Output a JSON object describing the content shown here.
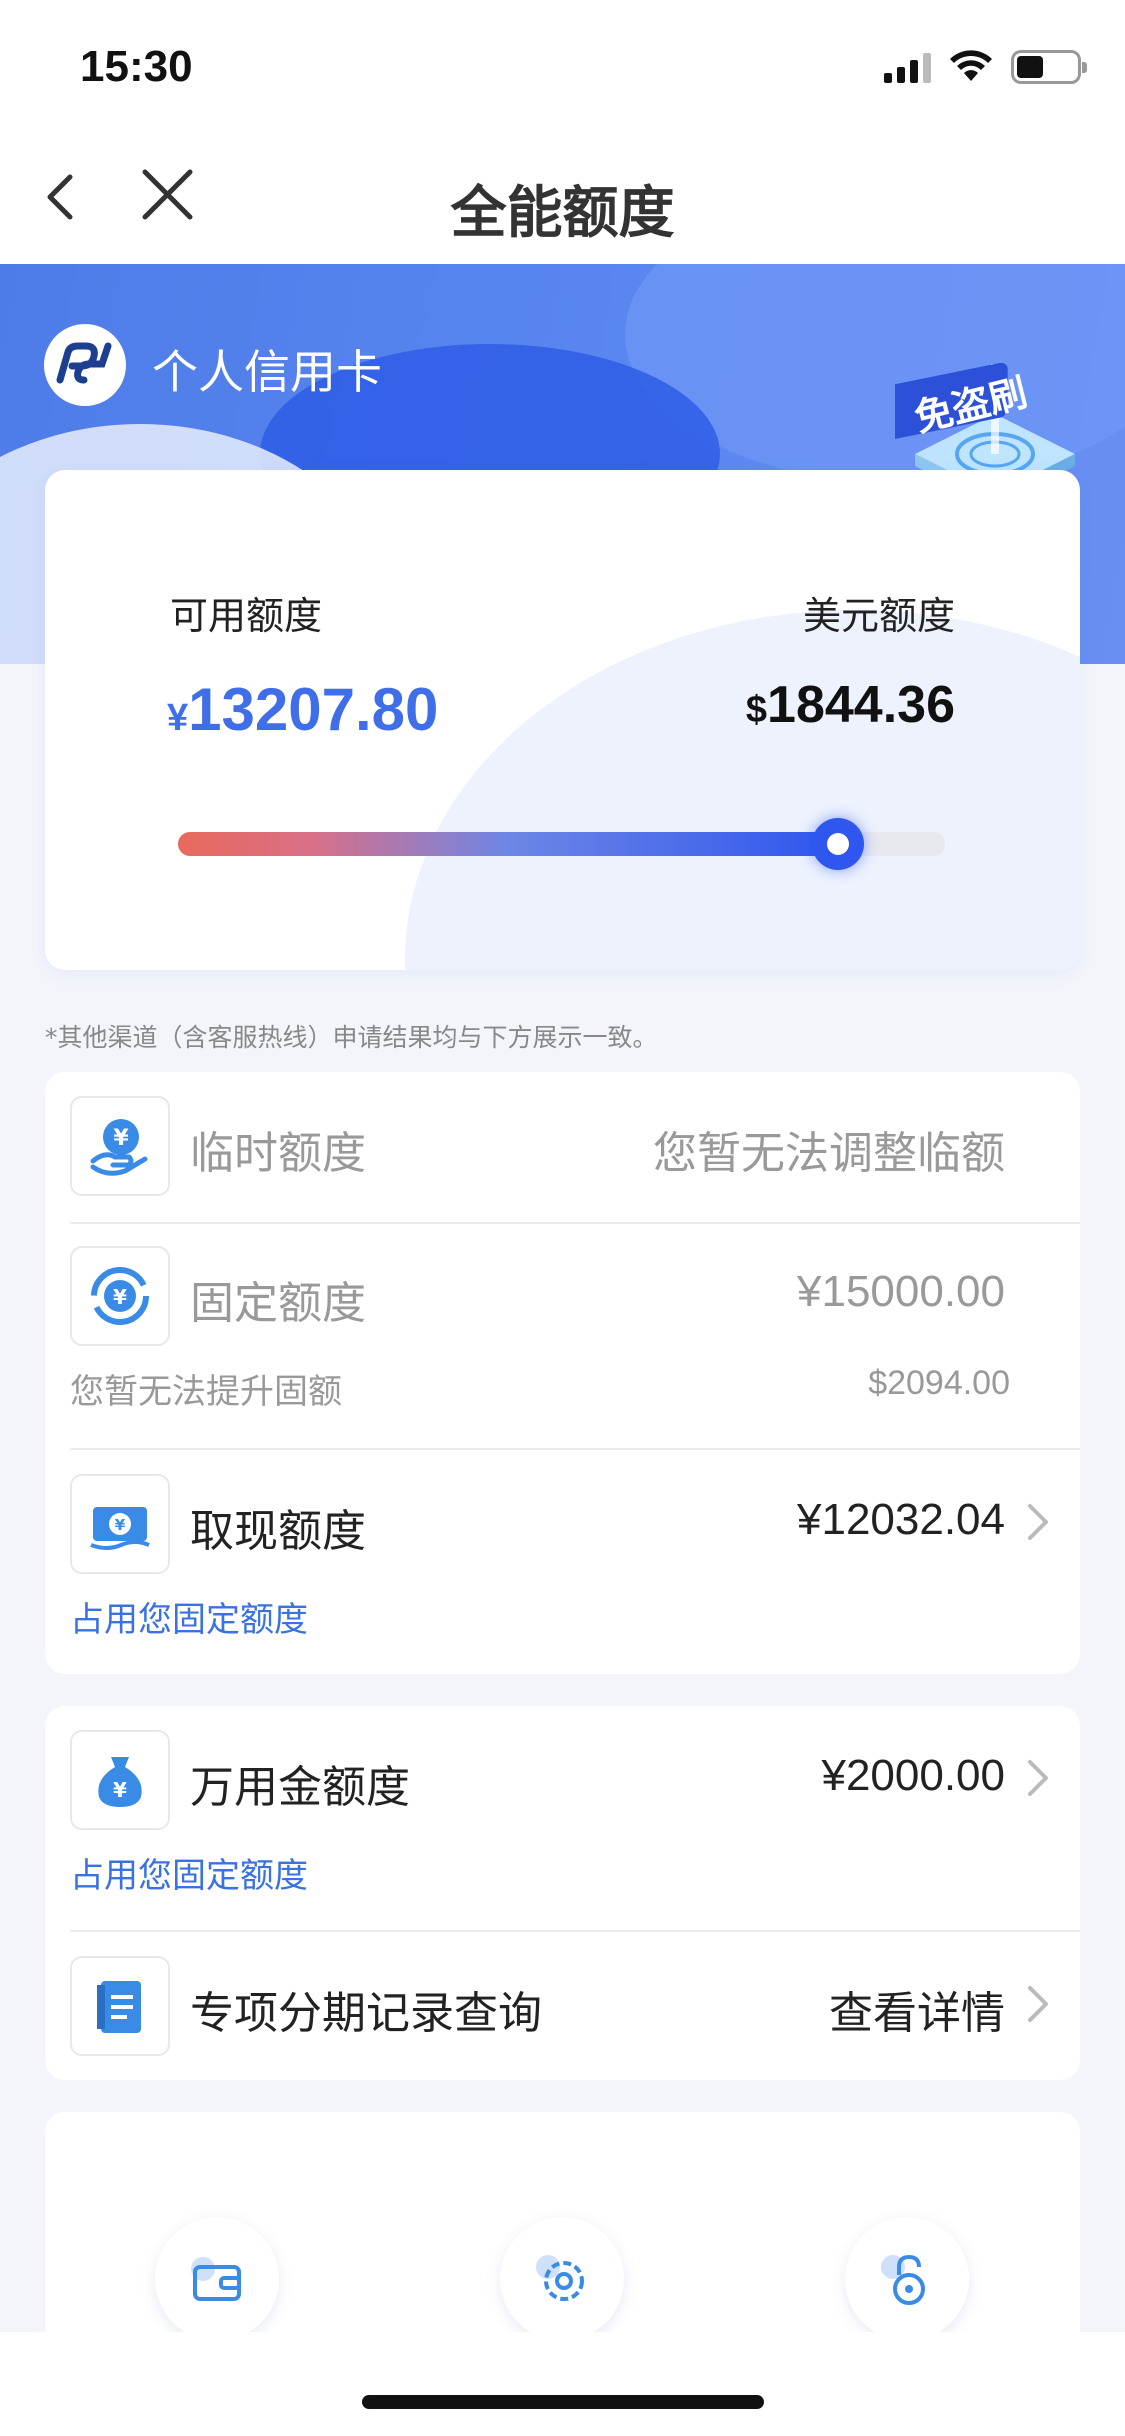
{
  "status_bar": {
    "time": "15:30"
  },
  "nav": {
    "title": "全能额度"
  },
  "brand": {
    "name": "个人信用卡",
    "badge_icon": "anti-fraud-badge-icon"
  },
  "limit_summary": {
    "available_label": "可用额度",
    "available_symbol": "¥",
    "available_value": "13207.80",
    "usd_label": "美元额度",
    "usd_symbol": "$",
    "usd_value": "1844.36",
    "usage_fraction": 0.86
  },
  "note": "*其他渠道（含客服热线）申请结果均与下方展示一致。",
  "limits_card": {
    "temporary": {
      "title": "临时额度",
      "value": "您暂无法调整临额",
      "icon": "temporary-limit-icon"
    },
    "fixed": {
      "title": "固定额度",
      "value": "¥15000.00",
      "sub_left": "您暂无法提升固额",
      "sub_right": "$2094.00",
      "icon": "fixed-limit-icon"
    },
    "cash": {
      "title": "取现额度",
      "value": "¥12032.04",
      "sub_left": "占用您固定额度",
      "icon": "cash-limit-icon"
    }
  },
  "services_card": {
    "wanyongjin": {
      "title": "万用金额度",
      "value": "¥2000.00",
      "sub_left": "占用您固定额度",
      "icon": "money-bag-icon"
    },
    "installment": {
      "title": "专项分期记录查询",
      "value": "查看详情",
      "icon": "document-icon"
    }
  },
  "quick_actions": [
    {
      "icon": "wallet-icon"
    },
    {
      "icon": "gear-icon"
    },
    {
      "icon": "lock-icon"
    }
  ],
  "colors": {
    "accent": "#3f6ee8",
    "link": "#3a72e0",
    "hero": "#5b86f0"
  }
}
